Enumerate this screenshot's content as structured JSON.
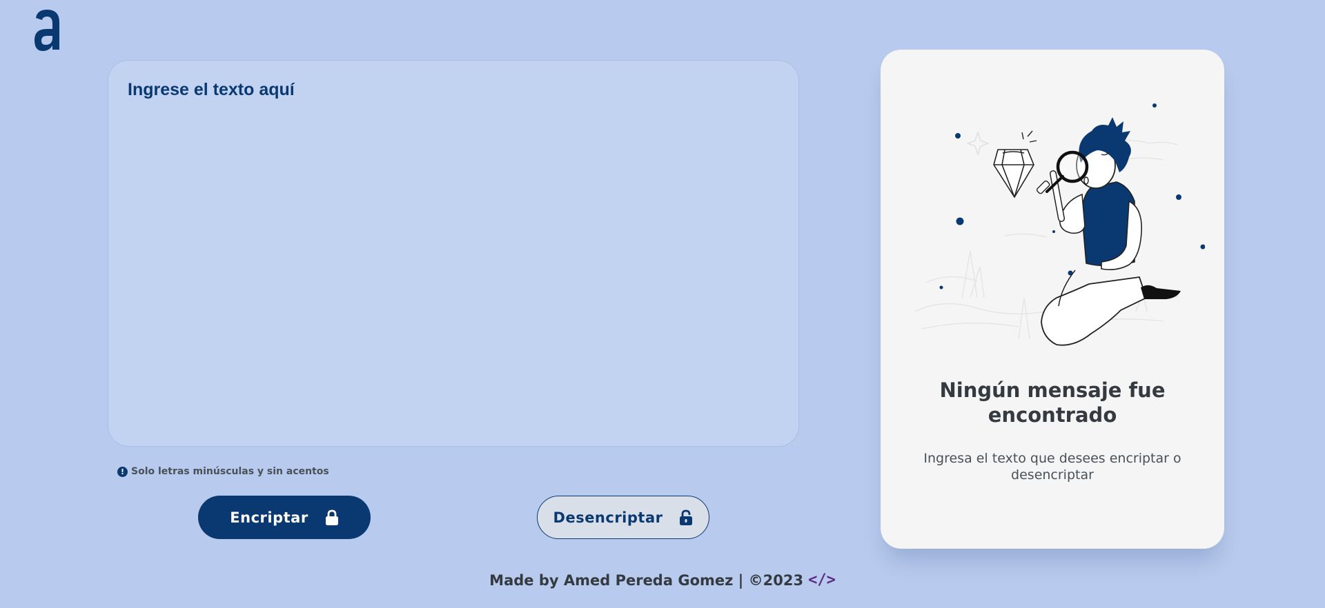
{
  "header": {
    "logo_icon": "alura-a-logo"
  },
  "input": {
    "placeholder": "Ingrese el texto aquí",
    "value": ""
  },
  "hint": {
    "icon": "exclamation-circle-icon",
    "text": "Solo letras minúsculas y sin acentos"
  },
  "buttons": {
    "encrypt_label": "Encriptar",
    "encrypt_icon": "lock-icon",
    "decrypt_label": "Desencriptar",
    "decrypt_icon": "unlock-icon"
  },
  "result_card": {
    "illustration": "boy-with-magnifying-glass-diamond",
    "title": "Ningún mensaje fue encontrado",
    "text": "Ingresa el texto que desees encriptar o desencriptar"
  },
  "footer": {
    "text": "Made by Amed Pereda Gomez | ©2023",
    "icon_text": "</>"
  },
  "colors": {
    "background": "#b8caed",
    "primary": "#0a3871",
    "card": "#f5f5f5",
    "textarea": "#c2d3f2"
  }
}
